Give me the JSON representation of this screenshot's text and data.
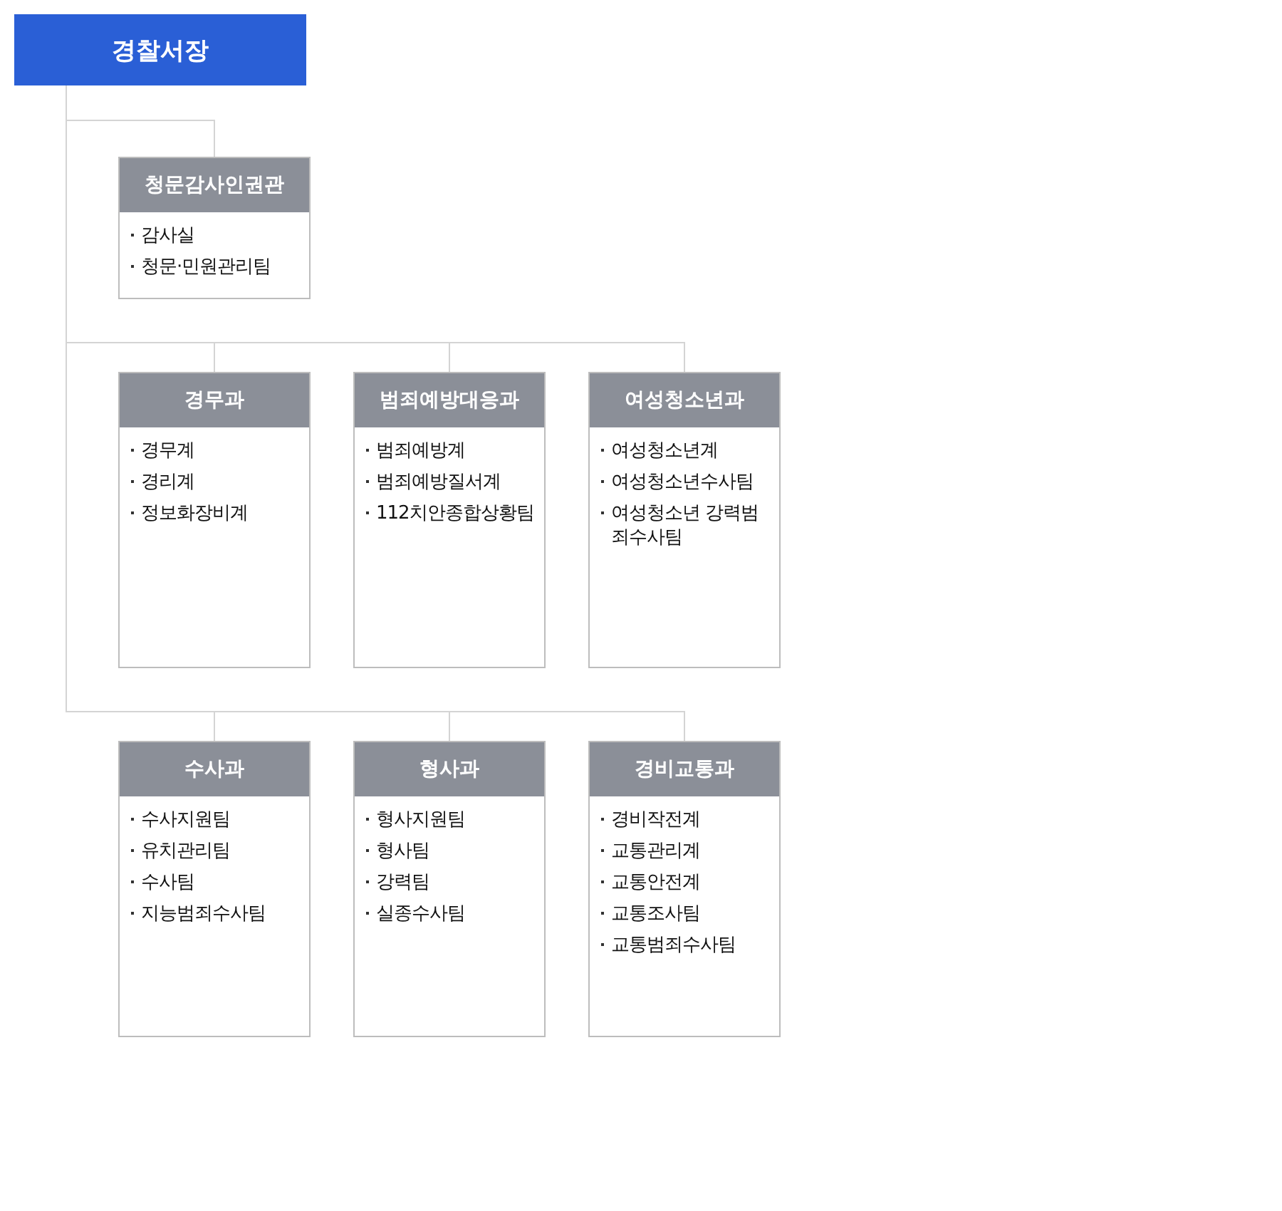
{
  "chief": {
    "title": "경찰서장"
  },
  "rows": [
    {
      "departments": [
        {
          "name": "청문감사인권관",
          "teams": [
            "감사실",
            "청문·민원관리팀"
          ]
        }
      ]
    },
    {
      "departments": [
        {
          "name": "경무과",
          "teams": [
            "경무계",
            "경리계",
            "정보화장비계"
          ]
        },
        {
          "name": "범죄예방대응과",
          "teams": [
            "범죄예방계",
            "범죄예방질서계",
            "112치안종합상황팀"
          ]
        },
        {
          "name": "여성청소년과",
          "teams": [
            "여성청소년계",
            "여성청소년수사팀",
            "여성청소년 강력범죄수사팀"
          ]
        }
      ]
    },
    {
      "departments": [
        {
          "name": "수사과",
          "teams": [
            "수사지원팀",
            "유치관리팀",
            "수사팀",
            "지능범죄수사팀"
          ]
        },
        {
          "name": "형사과",
          "teams": [
            "형사지원팀",
            "형사팀",
            "강력팀",
            "실종수사팀"
          ]
        },
        {
          "name": "경비교통과",
          "teams": [
            "경비작전계",
            "교통관리계",
            "교통안전계",
            "교통조사팀",
            "교통범죄수사팀"
          ]
        }
      ]
    }
  ]
}
